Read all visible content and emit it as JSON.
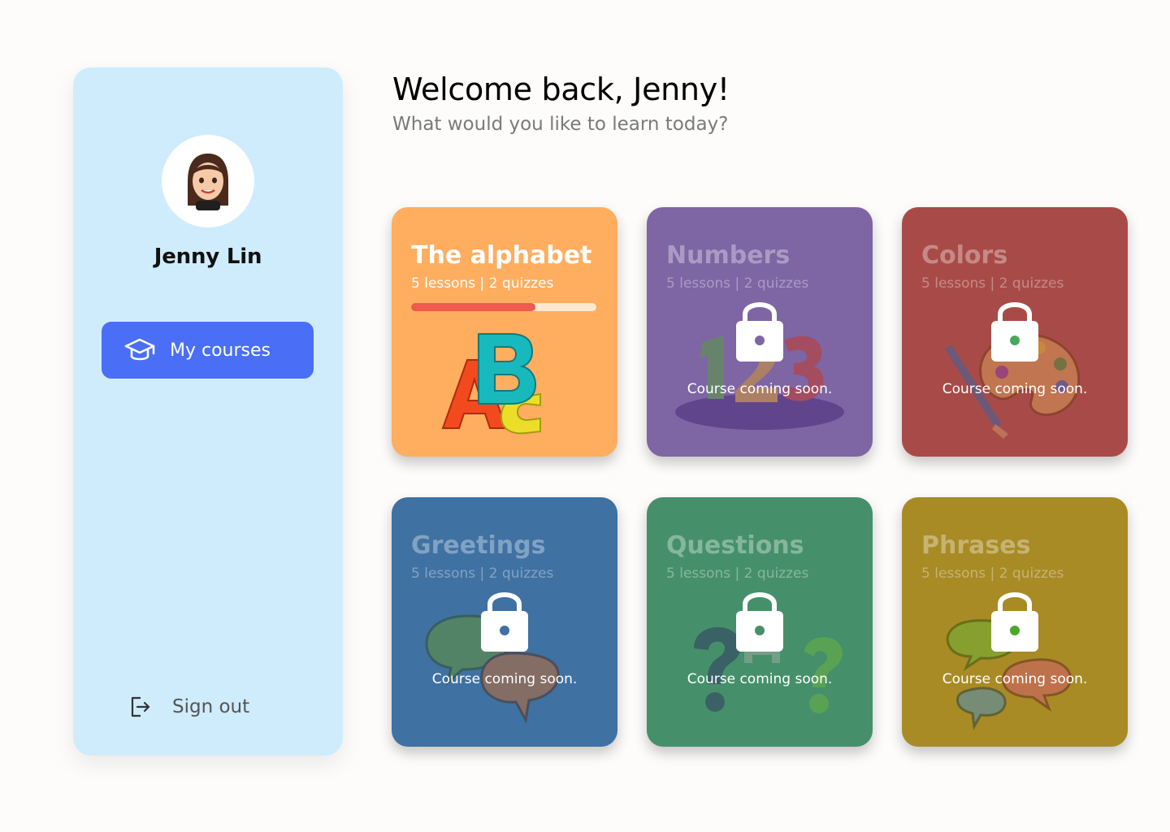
{
  "sidebar": {
    "user_name": "Jenny Lin",
    "nav": {
      "my_courses_label": "My courses",
      "icon": "graduation-cap-icon"
    },
    "sign_out_label": "Sign out"
  },
  "header": {
    "welcome": "Welcome back, Jenny!",
    "subtitle": "What would you like to learn today?"
  },
  "courses": [
    {
      "title": "The alphabet",
      "meta": "5 lessons | 2 quizzes",
      "color": "#ffad5f",
      "progress": 0.67,
      "locked": false,
      "illustration": "abc-letters"
    },
    {
      "title": "Numbers",
      "meta": "5 lessons | 2 quizzes",
      "color": "#7e65a4",
      "locked": true,
      "status": "Course coming soon.",
      "illustration": "123-numbers"
    },
    {
      "title": "Colors",
      "meta": "5 lessons | 2 quizzes",
      "color": "#a84b48",
      "locked": true,
      "status": "Course coming soon.",
      "illustration": "paint-palette"
    },
    {
      "title": "Greetings",
      "meta": "5 lessons | 2 quizzes",
      "color": "#3f71a3",
      "locked": true,
      "status": "Course coming soon.",
      "illustration": "hi-bye-bubbles"
    },
    {
      "title": "Questions",
      "meta": "5 lessons | 2 quizzes",
      "color": "#45906a",
      "locked": true,
      "status": "Course coming soon.",
      "illustration": "question-marks"
    },
    {
      "title": "Phrases",
      "meta": "5 lessons | 2 quizzes",
      "color": "#a88b25",
      "locked": true,
      "status": "Course coming soon.",
      "illustration": "speech-bubbles"
    }
  ]
}
